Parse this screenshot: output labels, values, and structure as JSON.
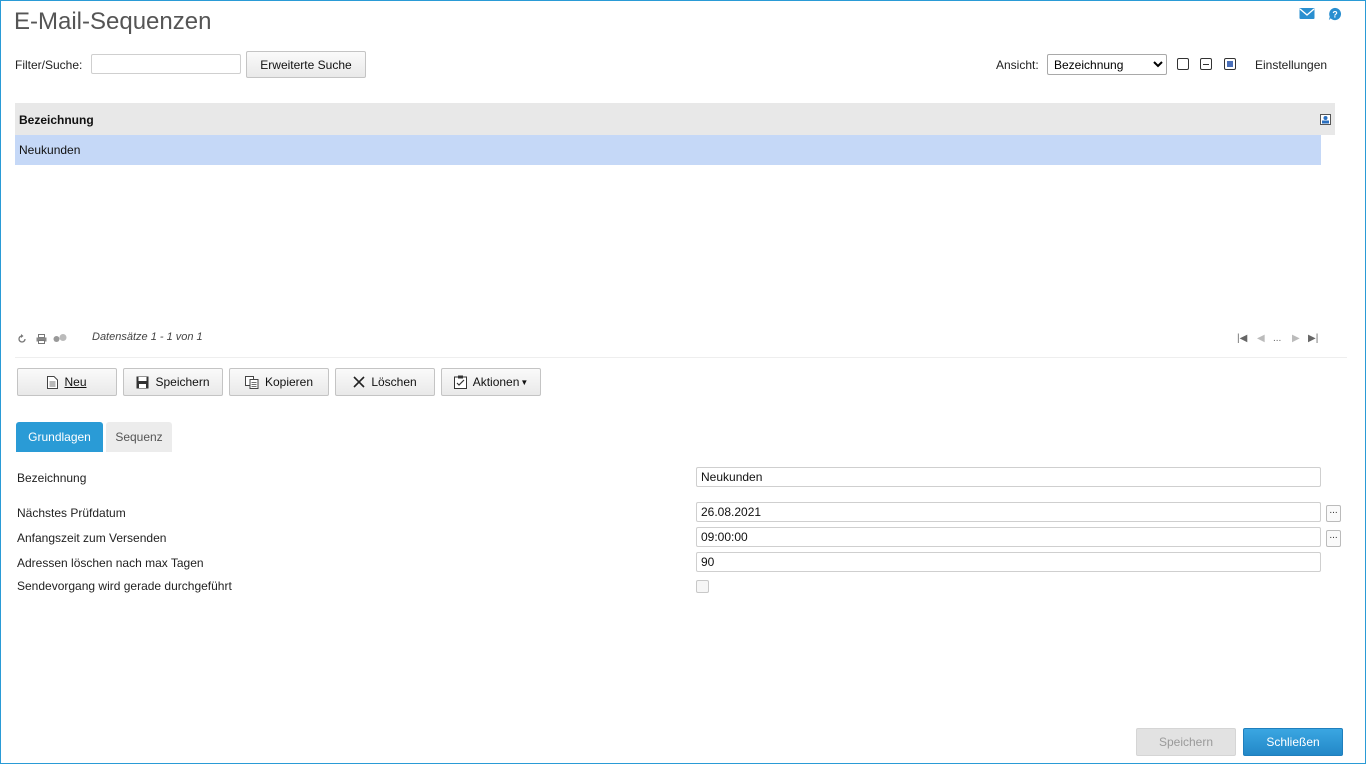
{
  "page": {
    "title": "E-Mail-Sequenzen"
  },
  "icons": {
    "mail": "mail-icon",
    "help": "help-icon"
  },
  "filter": {
    "label": "Filter/Suche:",
    "value": "",
    "advanced_search": "Erweiterte Suche"
  },
  "view": {
    "label": "Ansicht:",
    "selected": "Bezeichnung",
    "settings": "Einstellungen"
  },
  "grid": {
    "column": "Bezeichnung",
    "rows": [
      {
        "bezeichnung": "Neukunden",
        "selected": true
      }
    ],
    "records_info": "Datensätze 1 - 1 von 1",
    "pager_ellipsis": "..."
  },
  "toolbar": {
    "new": "Neu",
    "save": "Speichern",
    "copy": "Kopieren",
    "delete": "Löschen",
    "actions": "Aktionen"
  },
  "tabs": [
    {
      "label": "Grundlagen",
      "active": true
    },
    {
      "label": "Sequenz",
      "active": false
    }
  ],
  "form": {
    "bezeichnung_label": "Bezeichnung",
    "bezeichnung_value": "Neukunden",
    "pruefdatum_label": "Nächstes Prüfdatum",
    "pruefdatum_value": "26.08.2021",
    "anfangszeit_label": "Anfangszeit zum Versenden",
    "anfangszeit_value": "09:00:00",
    "adressen_label": "Adressen löschen nach max Tagen",
    "adressen_value": "90",
    "sendevorgang_label": "Sendevorgang wird gerade durchgeführt",
    "sendevorgang_checked": false,
    "picker_label": "..."
  },
  "footer": {
    "save": "Speichern",
    "close": "Schließen"
  },
  "colors": {
    "accent": "#2a9bd6",
    "selected_row": "#c5d8f7",
    "header_bg": "#e8e8e8"
  }
}
